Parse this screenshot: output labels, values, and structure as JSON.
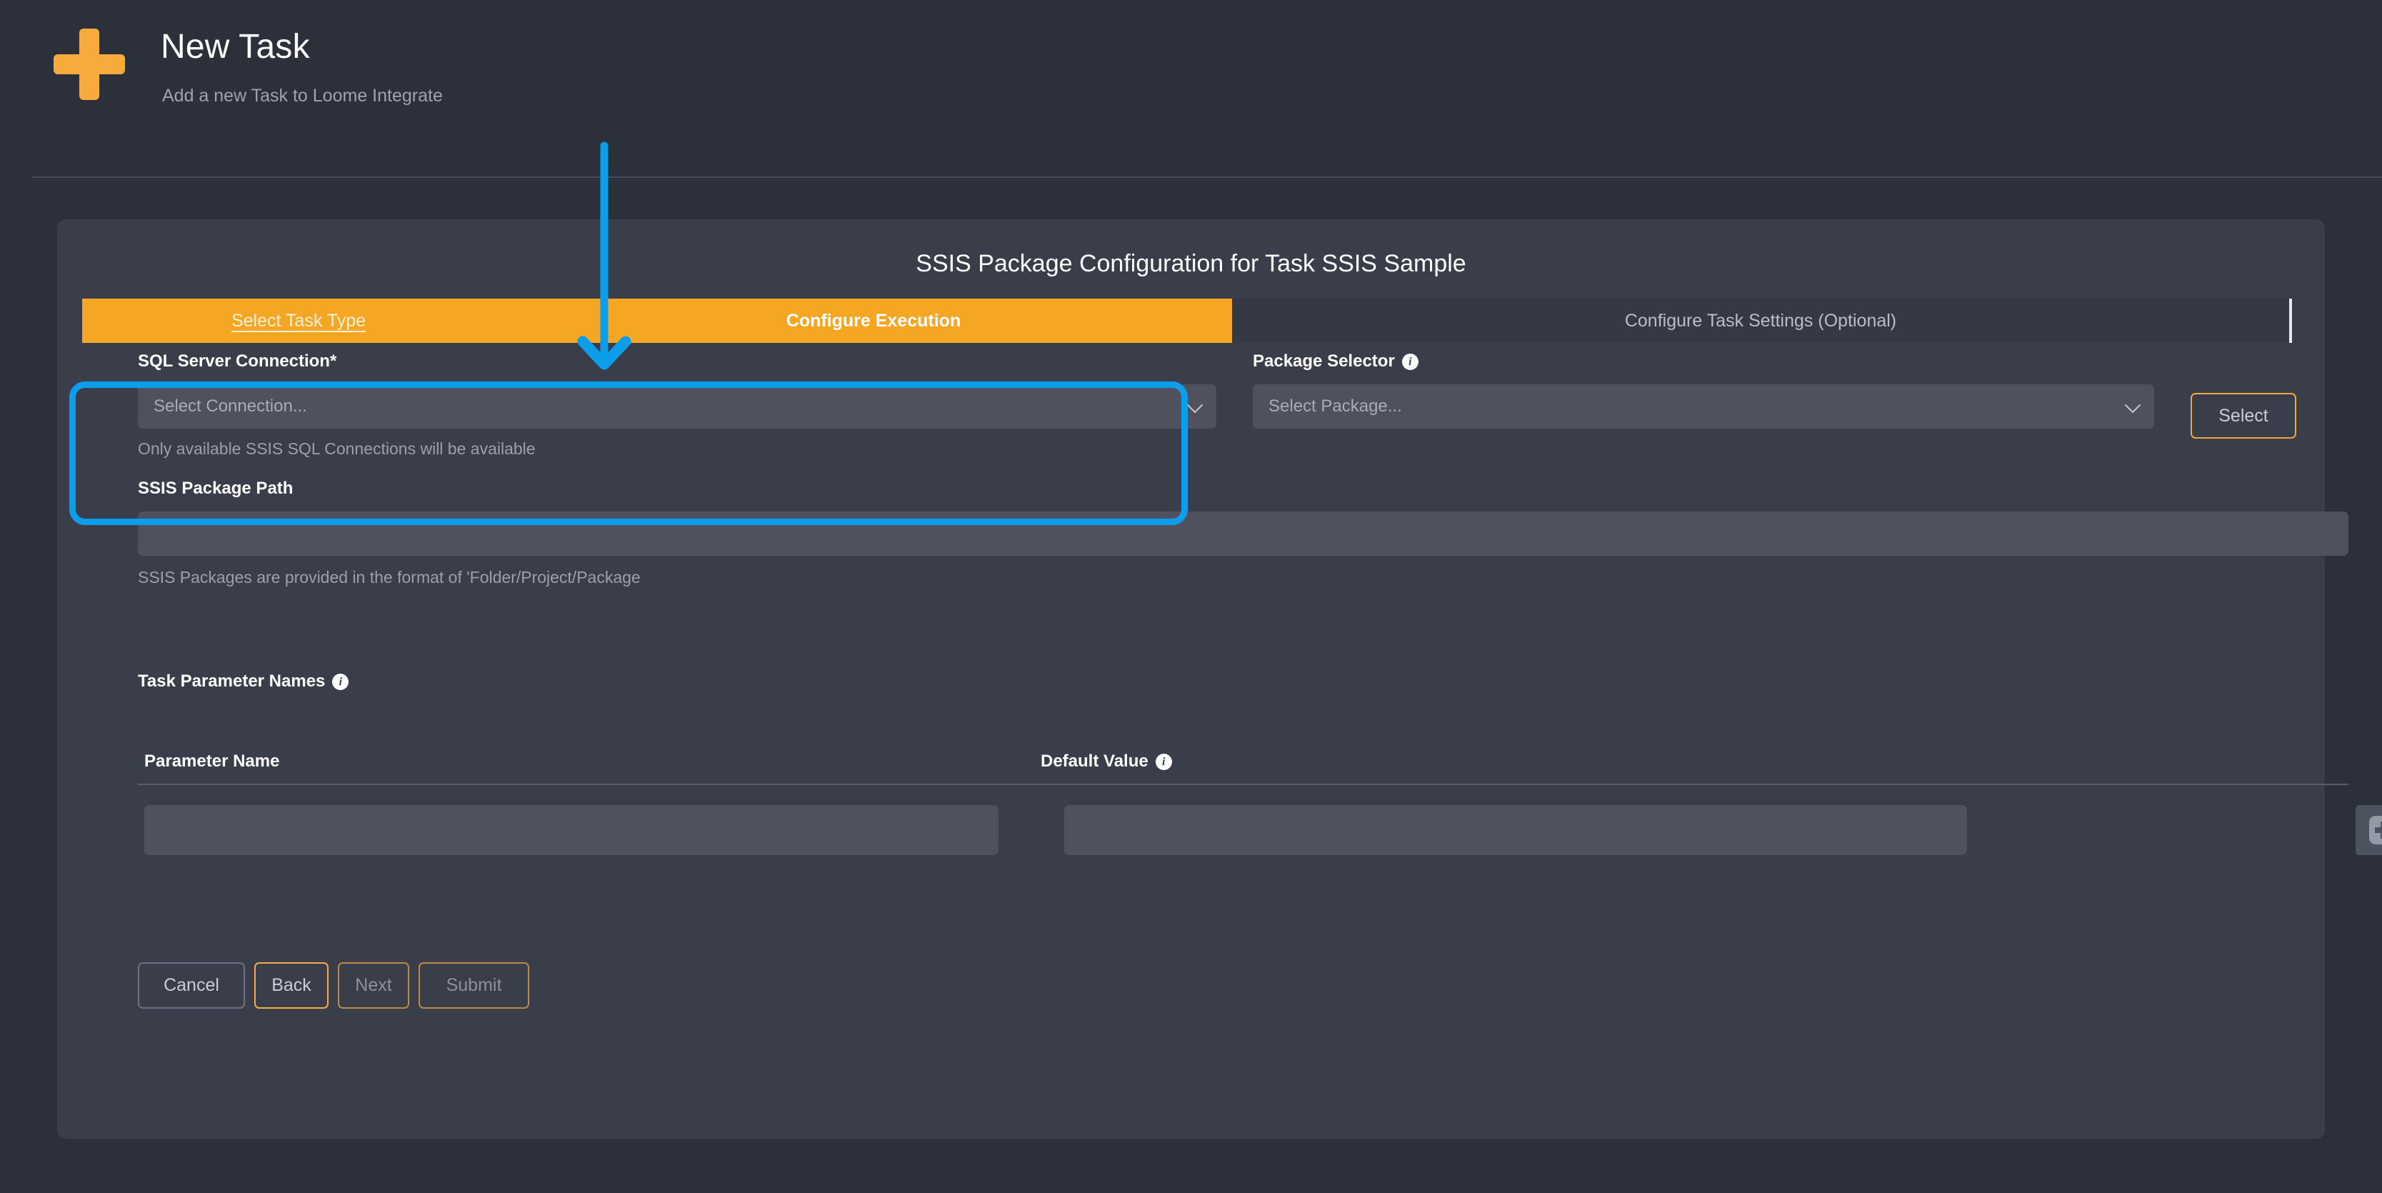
{
  "header": {
    "logo_icon": "plus-icon",
    "title": "New Task",
    "subtitle": "Add a new Task to Loome Integrate"
  },
  "card": {
    "title": "SSIS Package Configuration for Task SSIS Sample",
    "tabs": [
      {
        "label": "Select Task Type",
        "state": "completed"
      },
      {
        "label": "Configure Execution",
        "state": "active"
      },
      {
        "label": "Configure Task Settings (Optional)",
        "state": "inactive"
      }
    ]
  },
  "form": {
    "sql_connection": {
      "label": "SQL Server Connection*",
      "value": "",
      "placeholder": "Select Connection...",
      "hint": "Only available SSIS SQL Connections will be available",
      "chevron_icon": "chevron-down-icon"
    },
    "package_selector": {
      "label": "Package Selector",
      "info_icon": "info-icon",
      "value": "",
      "placeholder": "Select Package...",
      "chevron_icon": "chevron-down-icon",
      "select_button": "Select"
    },
    "package_path": {
      "label": "SSIS Package Path",
      "value": "",
      "placeholder": "",
      "hint": "SSIS Packages are provided in the format of 'Folder/Project/Package"
    },
    "task_parameters": {
      "label": "Task Parameter Names",
      "info_icon": "info-icon",
      "columns": [
        {
          "label": "Parameter Name",
          "info_icon": null
        },
        {
          "label": "Default Value",
          "info_icon": "info-icon"
        }
      ],
      "rows": [
        {
          "parameter_name": "",
          "default_value": ""
        }
      ],
      "add_row_icon": "plus-square-icon"
    }
  },
  "footer": {
    "cancel_label": "Cancel",
    "back_label": "Back",
    "next_label": "Next",
    "submit_label": "Submit"
  },
  "annotation": {
    "arrow_icon": "down-arrow-annotation",
    "arrow_color": "#0d9eeb",
    "highlight_color": "#0d9eeb",
    "highlight_target": "SQL Server Connection"
  },
  "colors": {
    "page_bg": "#2c303a",
    "card_bg": "#3a3e4a",
    "accent_orange": "#f5a623",
    "input_bg": "#4f525e",
    "annotation_blue": "#0d9eeb"
  }
}
